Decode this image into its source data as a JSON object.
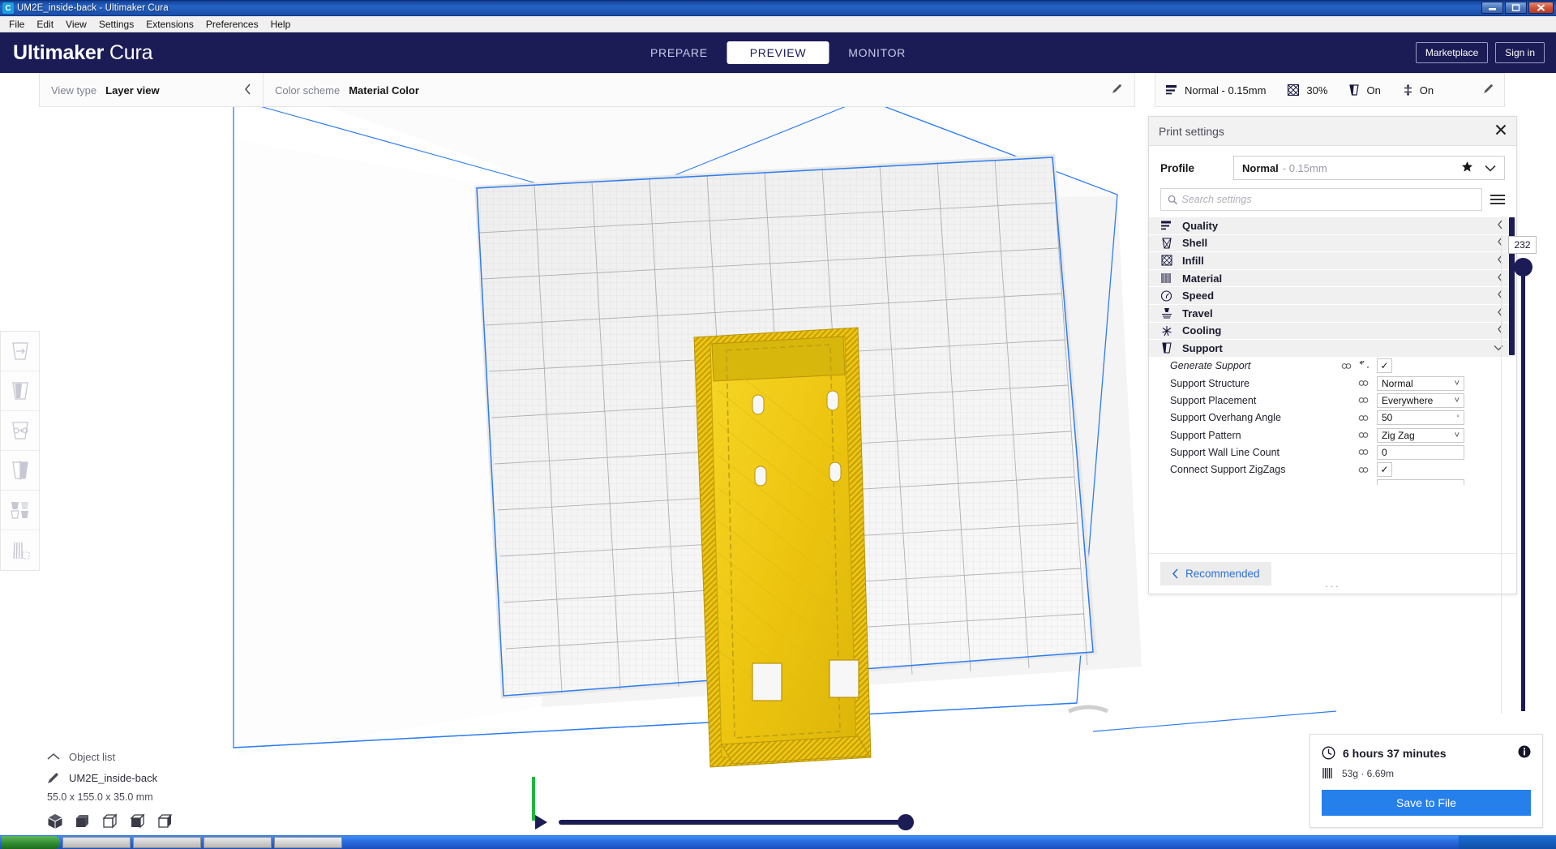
{
  "window": {
    "title": "UM2E_inside-back - Ultimaker Cura",
    "app_icon": "C",
    "minimize": "–",
    "maximize": "❐",
    "close": "✕"
  },
  "menubar": {
    "items": [
      "File",
      "Edit",
      "View",
      "Settings",
      "Extensions",
      "Preferences",
      "Help"
    ]
  },
  "header": {
    "logo_bold": "Ultimaker",
    "logo_light": "Cura",
    "tabs": [
      {
        "label": "PREPARE",
        "active": false
      },
      {
        "label": "PREVIEW",
        "active": true
      },
      {
        "label": "MONITOR",
        "active": false
      }
    ],
    "marketplace_label": "Marketplace",
    "signin_label": "Sign in",
    "bg_color": "#1b1b56"
  },
  "view_bar": {
    "view_type_label": "View type",
    "view_type_value": "Layer view",
    "color_scheme_label": "Color scheme",
    "color_scheme_value": "Material Color"
  },
  "config_bar": {
    "quality_label": "Normal - 0.15mm",
    "infill_label": "30%",
    "support_label": "On",
    "adhesion_label": "On"
  },
  "print_settings": {
    "title": "Print settings",
    "profile_label": "Profile",
    "profile_name": "Normal",
    "profile_sub": "- 0.15mm",
    "search_placeholder": "Search settings",
    "search_value": "",
    "categories": [
      {
        "name": "Quality",
        "icon": "quality-icon",
        "expanded": false
      },
      {
        "name": "Shell",
        "icon": "shell-icon",
        "expanded": false
      },
      {
        "name": "Infill",
        "icon": "infill-icon",
        "expanded": false
      },
      {
        "name": "Material",
        "icon": "material-icon",
        "expanded": false
      },
      {
        "name": "Speed",
        "icon": "speed-icon",
        "expanded": false
      },
      {
        "name": "Travel",
        "icon": "travel-icon",
        "expanded": false
      },
      {
        "name": "Cooling",
        "icon": "cooling-icon",
        "expanded": false
      },
      {
        "name": "Support",
        "icon": "support-icon",
        "expanded": true
      }
    ],
    "settings": [
      {
        "label": "Generate Support",
        "type": "checkbox",
        "value": "✓",
        "inherited": true,
        "has_revert": true
      },
      {
        "label": "Support Structure",
        "type": "dropdown",
        "value": "Normal",
        "inherited": false,
        "has_revert": false
      },
      {
        "label": "Support Placement",
        "type": "dropdown",
        "value": "Everywhere",
        "inherited": false,
        "has_revert": false
      },
      {
        "label": "Support Overhang Angle",
        "type": "number",
        "value": "50",
        "unit": "°",
        "inherited": false,
        "has_revert": false
      },
      {
        "label": "Support Pattern",
        "type": "dropdown",
        "value": "Zig Zag",
        "inherited": false,
        "has_revert": false
      },
      {
        "label": "Support Wall Line Count",
        "type": "number",
        "value": "0",
        "inherited": false,
        "has_revert": false
      },
      {
        "label": "Connect Support ZigZags",
        "type": "checkbox",
        "value": "✓",
        "inherited": false,
        "has_revert": false
      }
    ],
    "recommended_label": "Recommended",
    "grip": "···"
  },
  "layer_slider": {
    "value": "232",
    "max": "232"
  },
  "object_list": {
    "header": "Object list",
    "item_name": "UM2E_inside-back",
    "dimensions": "55.0 x 155.0 x 35.0 mm"
  },
  "job": {
    "time": "6 hours 37 minutes",
    "material": "53g · 6.69m",
    "save_label": "Save to File",
    "save_color": "#2680eb"
  },
  "colors": {
    "cura_navy": "#1b1b56",
    "accent_blue": "#2680eb",
    "model_yellow": "#f5cd18",
    "plate_outline": "#2d7df0"
  }
}
